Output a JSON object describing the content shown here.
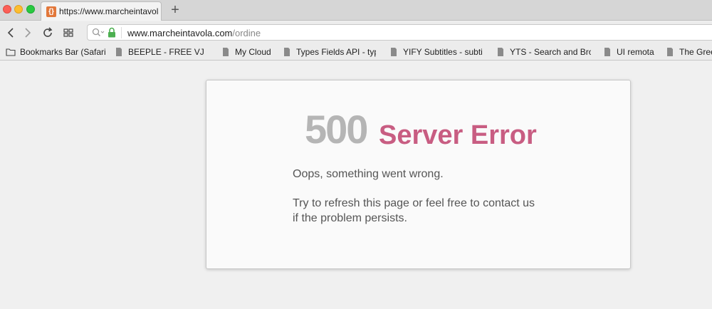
{
  "browser": {
    "tab": {
      "favicon_glyph": "{}",
      "title": "https://www.marcheintavola.c"
    },
    "new_tab_glyph": "+",
    "address_bar": {
      "host": "www.marcheintavola.com",
      "path": "/ordine",
      "secure": true
    },
    "bookmarks": [
      {
        "label": "Bookmarks Bar (Safari)",
        "icon": "folder-icon"
      },
      {
        "label": "BEEPLE - FREE VJ LO",
        "icon": "page-icon"
      },
      {
        "label": "My Cloud",
        "icon": "page-icon"
      },
      {
        "label": "Types Fields API - typ",
        "icon": "page-icon"
      },
      {
        "label": "YIFY Subtitles - subti",
        "icon": "page-icon"
      },
      {
        "label": "YTS - Search and Bro",
        "icon": "page-icon"
      },
      {
        "label": "UI remota",
        "icon": "page-icon"
      },
      {
        "label": "The Green",
        "icon": "page-icon"
      }
    ]
  },
  "error": {
    "code": "500",
    "title": "Server Error",
    "message": "Oops, something went wrong.",
    "detail": "Try to refresh this page or feel free to contact us if the problem persists."
  },
  "colors": {
    "code": "#b5b5b5",
    "title": "#c85d82",
    "text": "#555555",
    "lock": "#4caf50"
  }
}
